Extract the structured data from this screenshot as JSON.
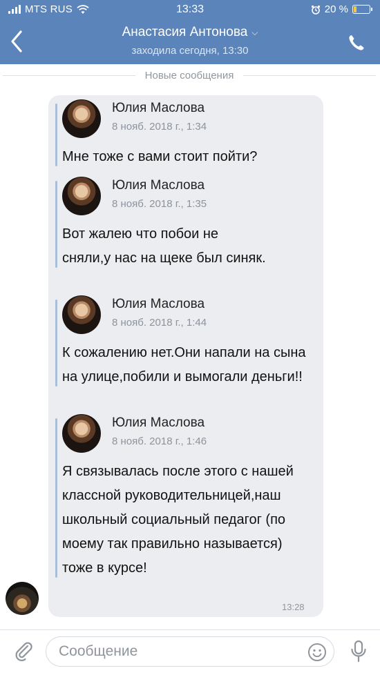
{
  "status_bar": {
    "carrier": "MTS RUS",
    "time": "13:33",
    "battery": "20 %",
    "battery_level": 0.2
  },
  "header": {
    "title": "Анастасия Антонова",
    "subtitle": "заходила сегодня, 13:30"
  },
  "divider": {
    "label": "Новые сообщения"
  },
  "messages": [
    {
      "name": "Юлия Маслова",
      "date": "8 нояб. 2018 г., 1:34",
      "text": "Мне тоже с вами стоит пойти?"
    },
    {
      "name": "Юлия Маслова",
      "date": "8 нояб. 2018 г., 1:35",
      "text": "Вот жалею что побои не сняли,у нас на щеке был синяк."
    },
    {
      "name": "Юлия Маслова",
      "date": "8 нояб. 2018 г., 1:44",
      "text": "К сожалению нет.Они напали на сына на улице,побили и вымогали деньги!!"
    },
    {
      "name": "Юлия Маслова",
      "date": "8 нояб. 2018 г., 1:46",
      "text": "Я связывалась после этого с нашей классной руководительницей,наш школьный социальный педагог (по моему так правильно называется) тоже в курсе!"
    }
  ],
  "bubble_time": "13:28",
  "input": {
    "placeholder": "Сообщение"
  },
  "colors": {
    "header": "#5b84ba",
    "bubble": "#ecedf1",
    "quote_bar": "#a9bfd8"
  }
}
